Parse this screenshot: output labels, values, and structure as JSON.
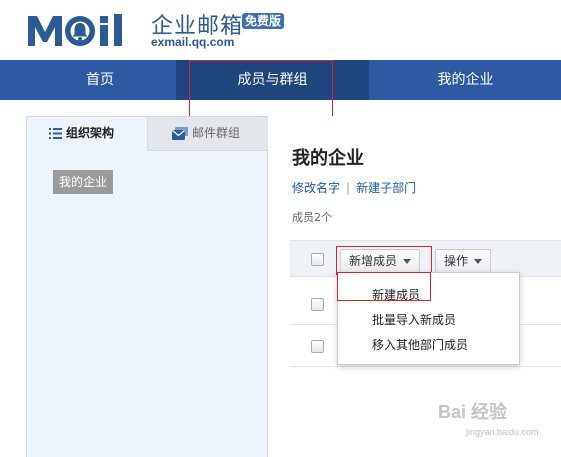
{
  "header": {
    "logo_text": "Mail",
    "brand_cn": "企业邮箱",
    "badge": "免费版",
    "url": "exmail.qq.com"
  },
  "nav": {
    "items": [
      {
        "label": "首页"
      },
      {
        "label": "成员与群组"
      },
      {
        "label": "我的企业"
      }
    ],
    "active_index": 1
  },
  "sidebar": {
    "tabs": [
      {
        "label": "组织架构",
        "icon": "list-icon"
      },
      {
        "label": "邮件群组",
        "icon": "mail-group-icon"
      }
    ],
    "org_root": "我的企业"
  },
  "main": {
    "title": "我的企业",
    "links": [
      "修改名字",
      "新建子部门"
    ],
    "link_separator": "|",
    "member_count": "成员2个",
    "toolbar": {
      "add_member_label": "新增成员",
      "actions_label": "操作"
    },
    "dropdown_items": [
      "新建成员",
      "批量导入新成员",
      "移入其他部门成员"
    ]
  },
  "watermark": {
    "brand": "Bai  经验",
    "sub": "jingyan.baidu.com"
  },
  "colors": {
    "nav_bg": "#2d5ba3",
    "nav_active": "#1f467f",
    "brand_blue": "#2b5a96",
    "highlight_red": "#d9232d",
    "sidebar_bg": "#eef4fb"
  }
}
